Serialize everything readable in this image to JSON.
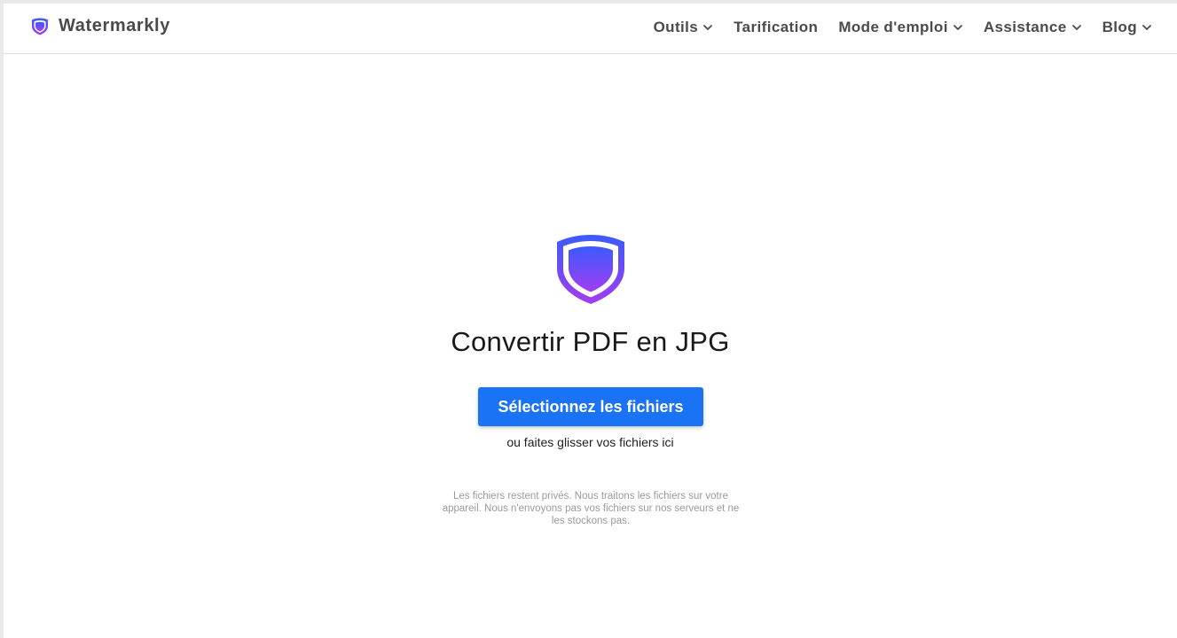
{
  "header": {
    "brand_name": "Watermarkly",
    "brand_icon": "shield-logo-icon",
    "nav": [
      {
        "label": "Outils",
        "has_dropdown": true
      },
      {
        "label": "Tarification",
        "has_dropdown": false
      },
      {
        "label": "Mode d'emploi",
        "has_dropdown": true
      },
      {
        "label": "Assistance",
        "has_dropdown": true
      },
      {
        "label": "Blog",
        "has_dropdown": true
      }
    ]
  },
  "main": {
    "hero_icon": "shield-logo-icon",
    "title": "Convertir PDF en JPG",
    "select_button_label": "Sélectionnez les fichiers",
    "drop_hint": "ou faites glisser vos fichiers ici",
    "privacy_note": "Les fichiers restent privés. Nous traitons les fichiers sur votre appareil. Nous n'envoyons pas vos fichiers sur nos serveurs et ne les stockons pas."
  },
  "colors": {
    "accent_button": "#1a73f5",
    "shield_gradient_top": "#3b5bff",
    "shield_gradient_bottom": "#a33cf0"
  }
}
